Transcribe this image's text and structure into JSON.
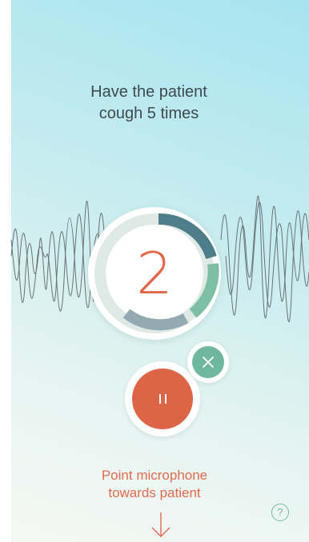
{
  "instruction": {
    "line1": "Have the patient",
    "line2": "cough 5 times"
  },
  "counter": {
    "value": "2"
  },
  "controls": {
    "pause_icon": "pause-icon",
    "close_icon": "close-icon"
  },
  "hint": {
    "line1": "Point microphone",
    "line2": "towards patient",
    "arrow_icon": "arrow-down-icon"
  },
  "help": {
    "label": "?"
  },
  "colors": {
    "accent": "#dd6547",
    "teal": "#6fb89f",
    "dark_teal": "#4e7e8a",
    "text": "#3f4a4f"
  }
}
